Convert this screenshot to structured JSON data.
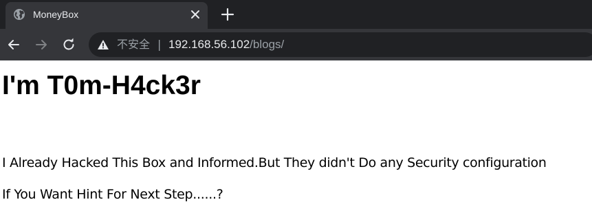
{
  "browser": {
    "tab": {
      "title": "MoneyBox",
      "favicon": "globe-icon",
      "close_icon": "close-icon"
    },
    "new_tab_icon": "plus-icon",
    "nav": {
      "back_icon": "arrow-left-icon",
      "forward_icon": "arrow-right-icon",
      "reload_icon": "reload-icon"
    },
    "omnibox": {
      "security_icon": "warning-icon",
      "security_label": "不安全",
      "separator": "|",
      "url_host": "192.168.56.102",
      "url_path": "/blogs/"
    },
    "colors": {
      "tabbar_bg": "#202124",
      "active_tab_bg": "#35363a",
      "omnibox_bg": "#202124",
      "text_primary": "#e8eaed",
      "text_muted": "#9aa0a6"
    }
  },
  "page": {
    "heading": "I'm T0m-H4ck3r",
    "paragraphs": [
      "I Already Hacked This Box and Informed.But They didn't Do any Security configuration",
      "If You Want Hint For Next Step......?"
    ]
  }
}
